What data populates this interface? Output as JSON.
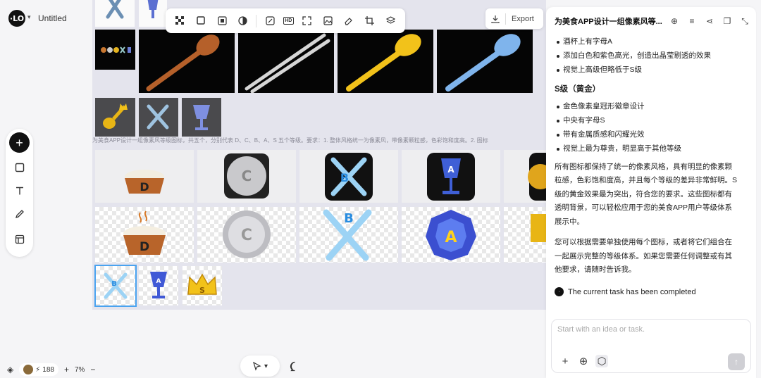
{
  "app": {
    "logo_text": "·LO",
    "doc_title": "Untitled"
  },
  "toolbar": {
    "items": [
      "remove-bg-icon",
      "crop-frame-icon",
      "upscale-icon",
      "style-icon",
      "text-edit-icon",
      "hd-icon",
      "expand-icon",
      "image-edit-icon",
      "eraser-icon",
      "crop-icon",
      "layers-icon"
    ],
    "hd_label": "HD"
  },
  "export": {
    "label": "Export"
  },
  "canvas": {
    "prompt_text": "为美食APP设计一组像素风等级图标，共五个，分别代表 D、C、B、A、S 五个等级。要求：1. 整体风格统一为像素风，带像素颗粒感，色彩饱和度高。2. 图标",
    "row2_letters": [
      "D",
      "C",
      "B",
      "A"
    ],
    "thumb_letters": [
      "B",
      "A",
      "S"
    ]
  },
  "bottom": {
    "credits": "188",
    "zoom_level": "7%",
    "zoom_in": "+",
    "zoom_out": "−"
  },
  "panel": {
    "title": "为美食APP设计一组像素风等...",
    "list_a": [
      "酒杯上有字母A",
      "添加白色和紫色高光，创造出晶莹剔透的效果",
      "视觉上高级但略低于S级"
    ],
    "s_heading": "S级（黄金）",
    "list_s": [
      "金色像素皇冠形徽章设计",
      "中央有字母S",
      "带有金属质感和闪耀光效",
      "视觉上最为尊贵，明显高于其他等级"
    ],
    "para1": "所有图标都保持了统一的像素风格，具有明显的像素颗粒感，色彩饱和度高，并且每个等级的差异非常鲜明。S级的黄金效果最为突出，符合您的要求。这些图标都有透明背景，可以轻松应用于您的美食APP用户等级体系展示中。",
    "para2": "您可以根据需要单独使用每个图标，或者将它们组合在一起展示完整的等级体系。如果您需要任何调整或有其他要求，请随时告诉我。",
    "done_text": "The current task has been completed",
    "composer_placeholder": "Start with an idea or task."
  }
}
